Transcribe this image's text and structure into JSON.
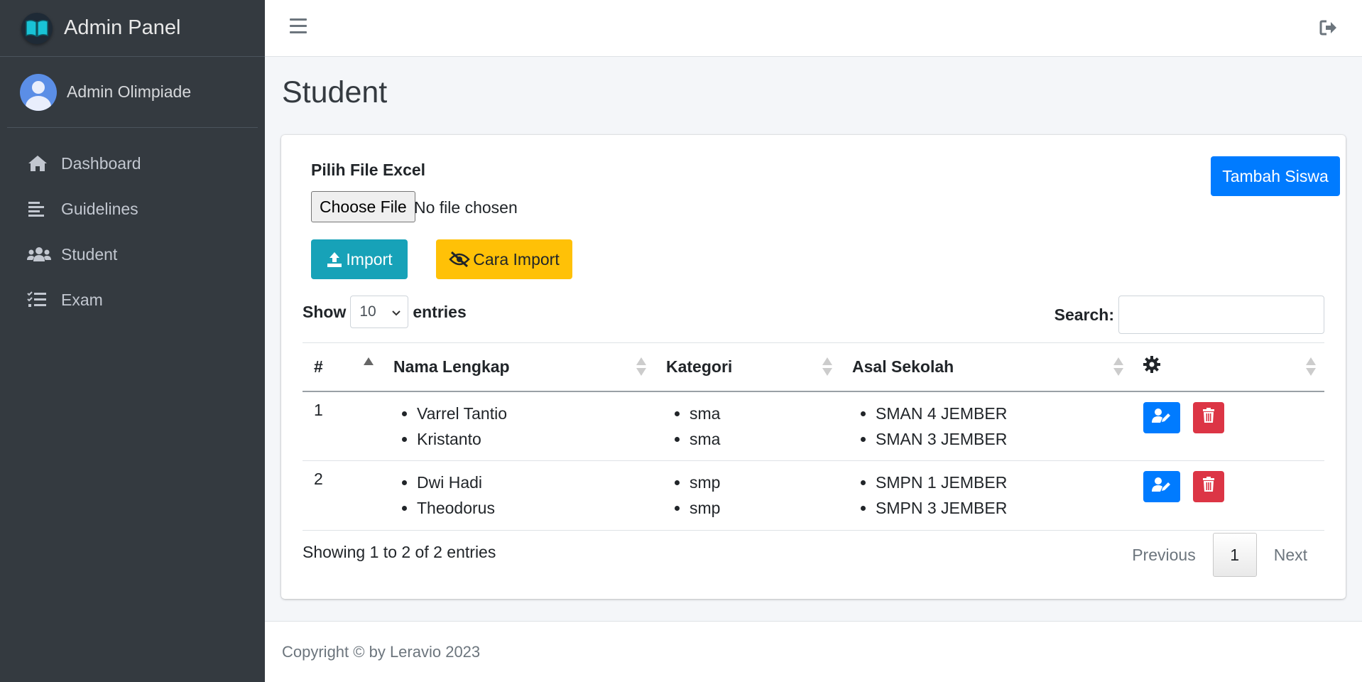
{
  "brand": {
    "title": "Admin Panel"
  },
  "user": {
    "name": "Admin Olimpiade"
  },
  "sidebar": {
    "items": [
      {
        "label": "Dashboard",
        "icon": "home-icon"
      },
      {
        "label": "Guidelines",
        "icon": "align-left-icon"
      },
      {
        "label": "Student",
        "icon": "users-icon"
      },
      {
        "label": "Exam",
        "icon": "tasks-icon"
      }
    ]
  },
  "page": {
    "title": "Student"
  },
  "upload": {
    "label": "Pilih File Excel",
    "choose_label": "Choose File",
    "no_file": "No file chosen",
    "import_label": "Import",
    "cara_label": "Cara Import",
    "tambah_label": "Tambah Siswa"
  },
  "controls": {
    "show_label": "Show",
    "entries_value": "10",
    "entries_label": "entries",
    "search_label": "Search:",
    "search_value": ""
  },
  "table": {
    "headers": {
      "num": "#",
      "nama": "Nama Lengkap",
      "kategori": "Kategori",
      "asal": "Asal Sekolah"
    },
    "rows": [
      {
        "num": "1",
        "nama": [
          "Varrel Tantio",
          "Kristanto"
        ],
        "kategori": [
          "sma",
          "sma"
        ],
        "asal": [
          "SMAN 4 JEMBER",
          "SMAN 3 JEMBER"
        ]
      },
      {
        "num": "2",
        "nama": [
          "Dwi Hadi",
          "Theodorus"
        ],
        "kategori": [
          "smp",
          "smp"
        ],
        "asal": [
          "SMPN 1 JEMBER",
          "SMPN 3 JEMBER"
        ]
      }
    ]
  },
  "pagination": {
    "info": "Showing 1 to 2 of 2 entries",
    "previous": "Previous",
    "current": "1",
    "next": "Next"
  },
  "footer": {
    "text": "Copyright © by Leravio 2023"
  },
  "colors": {
    "sidebar_bg": "#343a40",
    "primary": "#007bff",
    "info": "#17a2b8",
    "warning": "#ffc107",
    "danger": "#dc3545"
  }
}
